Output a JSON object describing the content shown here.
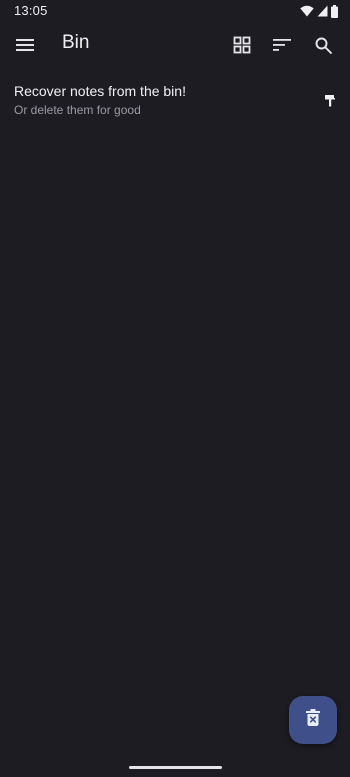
{
  "status_bar": {
    "time": "13:05",
    "icons": [
      "wifi-icon",
      "cellular-signal-icon",
      "battery-icon"
    ]
  },
  "app_bar": {
    "title": "Bin",
    "actions": [
      "menu-icon",
      "grid-view-icon",
      "sort-icon",
      "search-icon"
    ]
  },
  "info_banner": {
    "title": "Recover notes from the bin!",
    "subtitle": "Or delete them for good",
    "icon": "paint-brush-icon"
  },
  "fab": {
    "icon": "delete-forever-icon"
  },
  "colors": {
    "background": "#1c1c22",
    "fab": "#3f4f8a",
    "text_primary": "#f2f2f4",
    "text_secondary": "#9a9aa2"
  }
}
